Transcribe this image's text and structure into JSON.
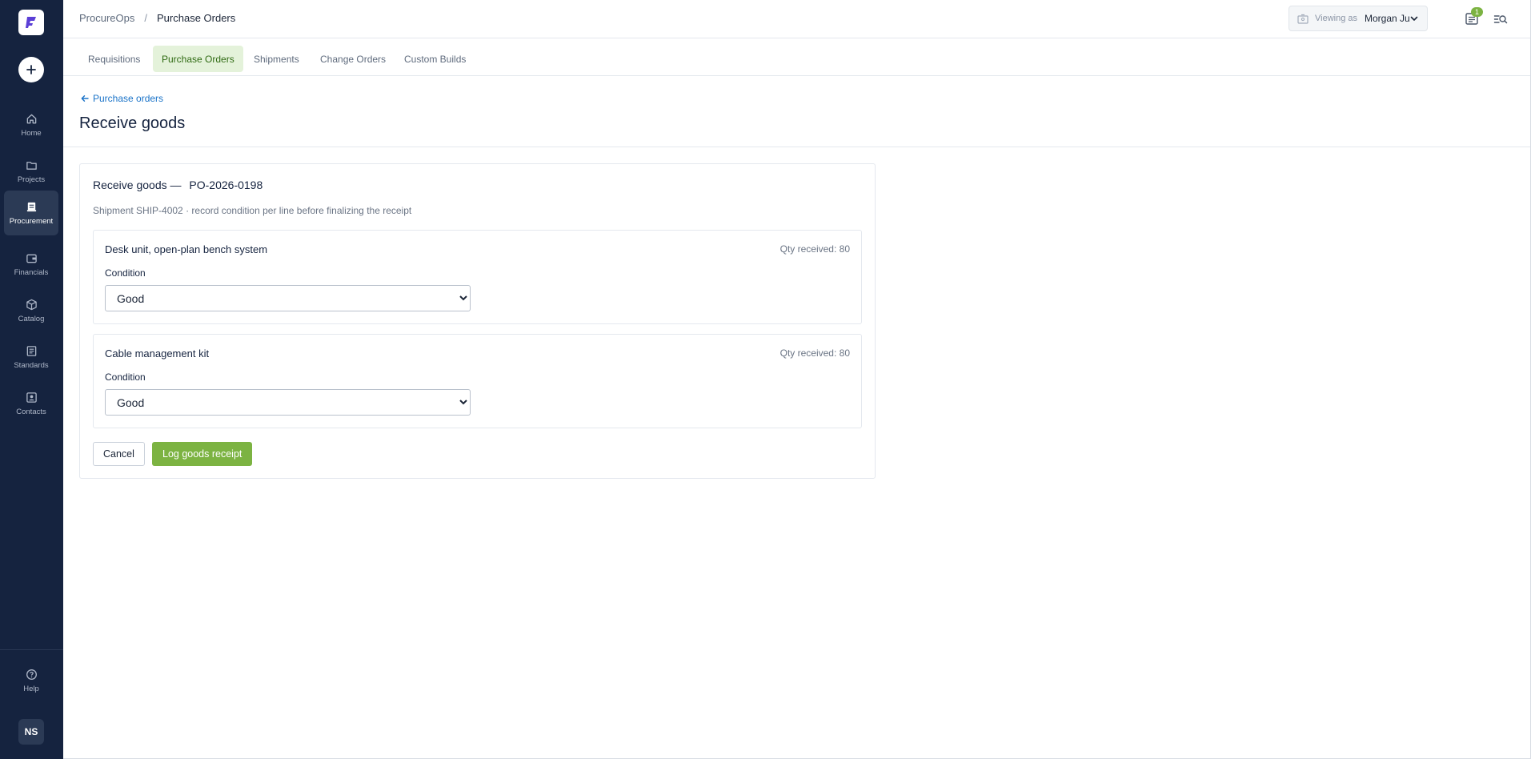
{
  "sidebar": {
    "logo_icon": "brand-logo-icon",
    "add_icon": "plus-icon",
    "items": [
      {
        "label": "Home",
        "icon": "home-icon"
      },
      {
        "label": "Projects",
        "icon": "folder-icon"
      },
      {
        "label": "Procurement",
        "icon": "procurement-icon",
        "active": true
      },
      {
        "label": "Financials",
        "icon": "wallet-icon"
      },
      {
        "label": "Catalog",
        "icon": "cube-icon"
      },
      {
        "label": "Standards",
        "icon": "document-icon"
      },
      {
        "label": "Contacts",
        "icon": "contact-card-icon"
      }
    ],
    "help": {
      "label": "Help",
      "icon": "help-icon"
    },
    "avatar_initials": "NS"
  },
  "header": {
    "breadcrumb_root": "ProcureOps",
    "breadcrumb_separator": "/",
    "breadcrumb_current": "Purchase Orders",
    "viewing_as_label": "Viewing as",
    "viewing_as_name": "Morgan Ju",
    "notification_count": "1"
  },
  "tabs": [
    {
      "label": "Requisitions"
    },
    {
      "label": "Purchase Orders",
      "active": true
    },
    {
      "label": "Shipments"
    },
    {
      "label": "Change Orders"
    },
    {
      "label": "Custom Builds"
    }
  ],
  "page": {
    "back_link": "Purchase orders",
    "title": "Receive goods"
  },
  "card": {
    "title_prefix": "Receive goods —",
    "po_number": "PO-2026-0198",
    "subtitle": "Shipment SHIP-4002 · record condition per line before finalizing the receipt",
    "lines": [
      {
        "name": "Desk unit, open-plan bench system",
        "qty": "Qty received: 80",
        "condition_label": "Condition",
        "condition_value": "Good"
      },
      {
        "name": "Cable management kit",
        "qty": "Qty received: 80",
        "condition_label": "Condition",
        "condition_value": "Good"
      }
    ],
    "cancel_label": "Cancel",
    "submit_label": "Log goods receipt"
  },
  "colors": {
    "sidebar_bg": "#15233f",
    "accent_green": "#7cb342",
    "active_tab_bg": "#e4f2da",
    "link_blue": "#1a73c8"
  }
}
